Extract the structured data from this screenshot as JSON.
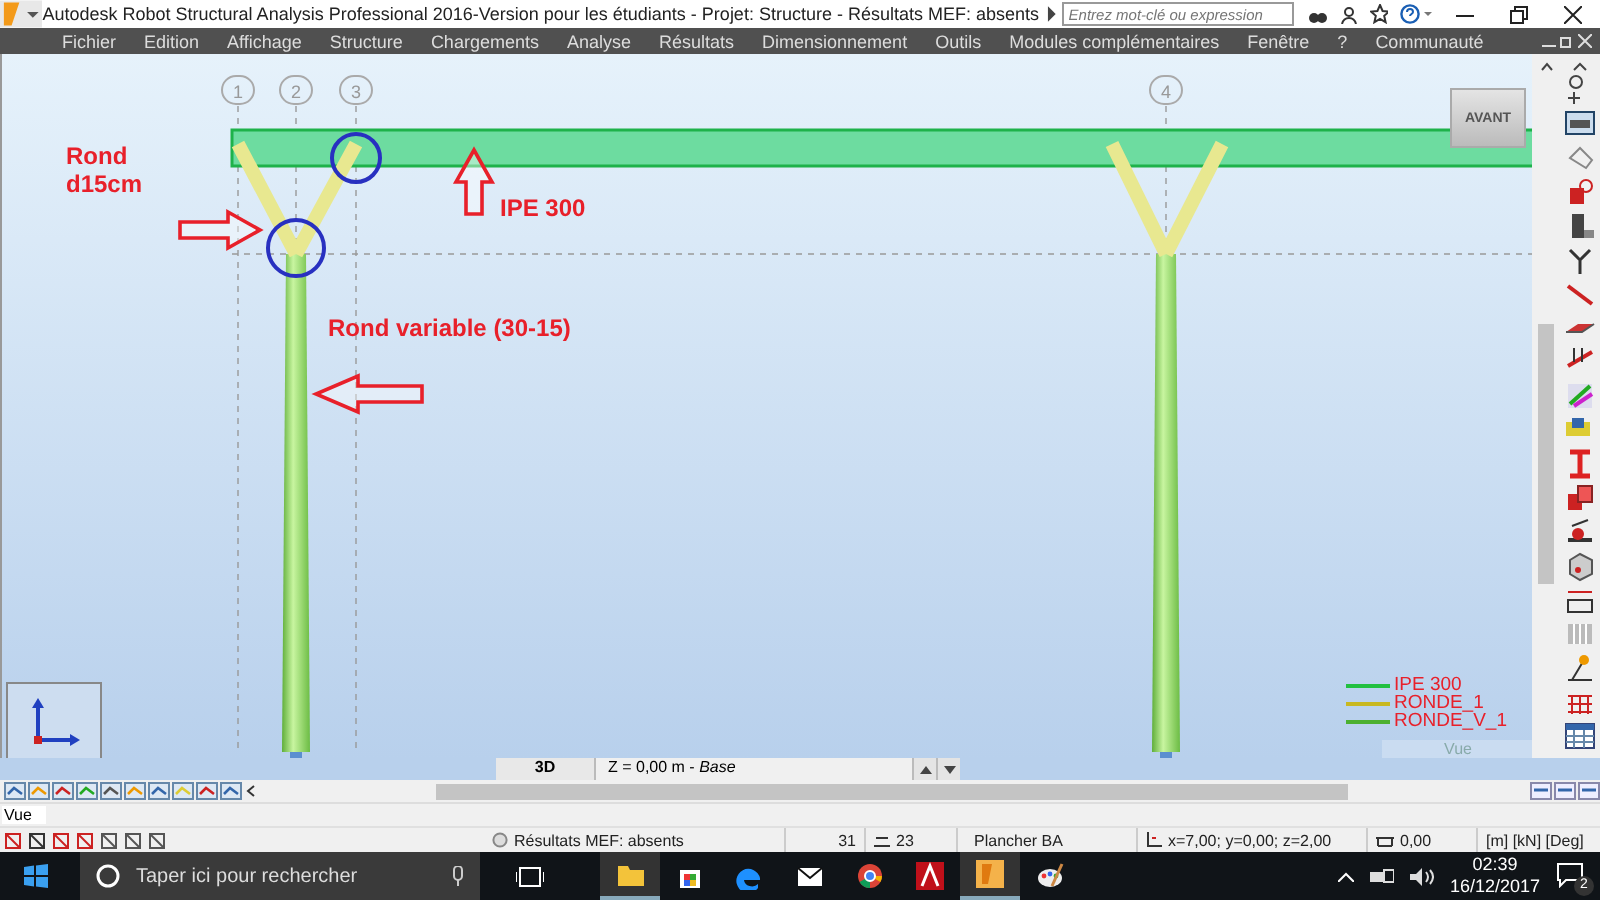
{
  "window": {
    "title": "Autodesk Robot Structural Analysis Professional 2016-Version pour les étudiants - Projet: Structure - Résultats MEF: absents",
    "search_placeholder": "Entrez mot-clé ou expression"
  },
  "menu": [
    "Fichier",
    "Edition",
    "Affichage",
    "Structure",
    "Chargements",
    "Analyse",
    "Résultats",
    "Dimensionnement",
    "Outils",
    "Modules complémentaires",
    "Fenêtre",
    "?",
    "Communauté"
  ],
  "viewport": {
    "grid_labels": [
      "1",
      "2",
      "3",
      "4"
    ],
    "view_cube_label": "AVANT",
    "annotations": [
      {
        "kind": "label",
        "text": "Rond\nd15cm"
      },
      {
        "kind": "label",
        "text": "IPE 300"
      },
      {
        "kind": "label",
        "text": "Rond variable (30-15)"
      }
    ],
    "legend": [
      {
        "label": "IPE 300",
        "color": "#22c040"
      },
      {
        "label": "RONDE_1",
        "color": "#c8b820"
      },
      {
        "label": "RONDE_V_1",
        "color": "#4cb030"
      }
    ],
    "ghost_label": "Vue"
  },
  "view_bar": {
    "tab": "3D",
    "level": "Z = 0,00 m - *Base*"
  },
  "command_field": {
    "value": "Vue"
  },
  "status_bar": {
    "message": "Résultats MEF: absents",
    "field_1": "31",
    "field_2": "23",
    "section": "Plancher BA",
    "coordinates": "x=7,00; y=0,00; z=2,00",
    "angle": "0,00",
    "units": "[m] [kN] [Deg]"
  },
  "taskbar": {
    "search_placeholder": "Taper ici pour rechercher",
    "time": "02:39",
    "date": "16/12/2017",
    "notifications": "2"
  }
}
